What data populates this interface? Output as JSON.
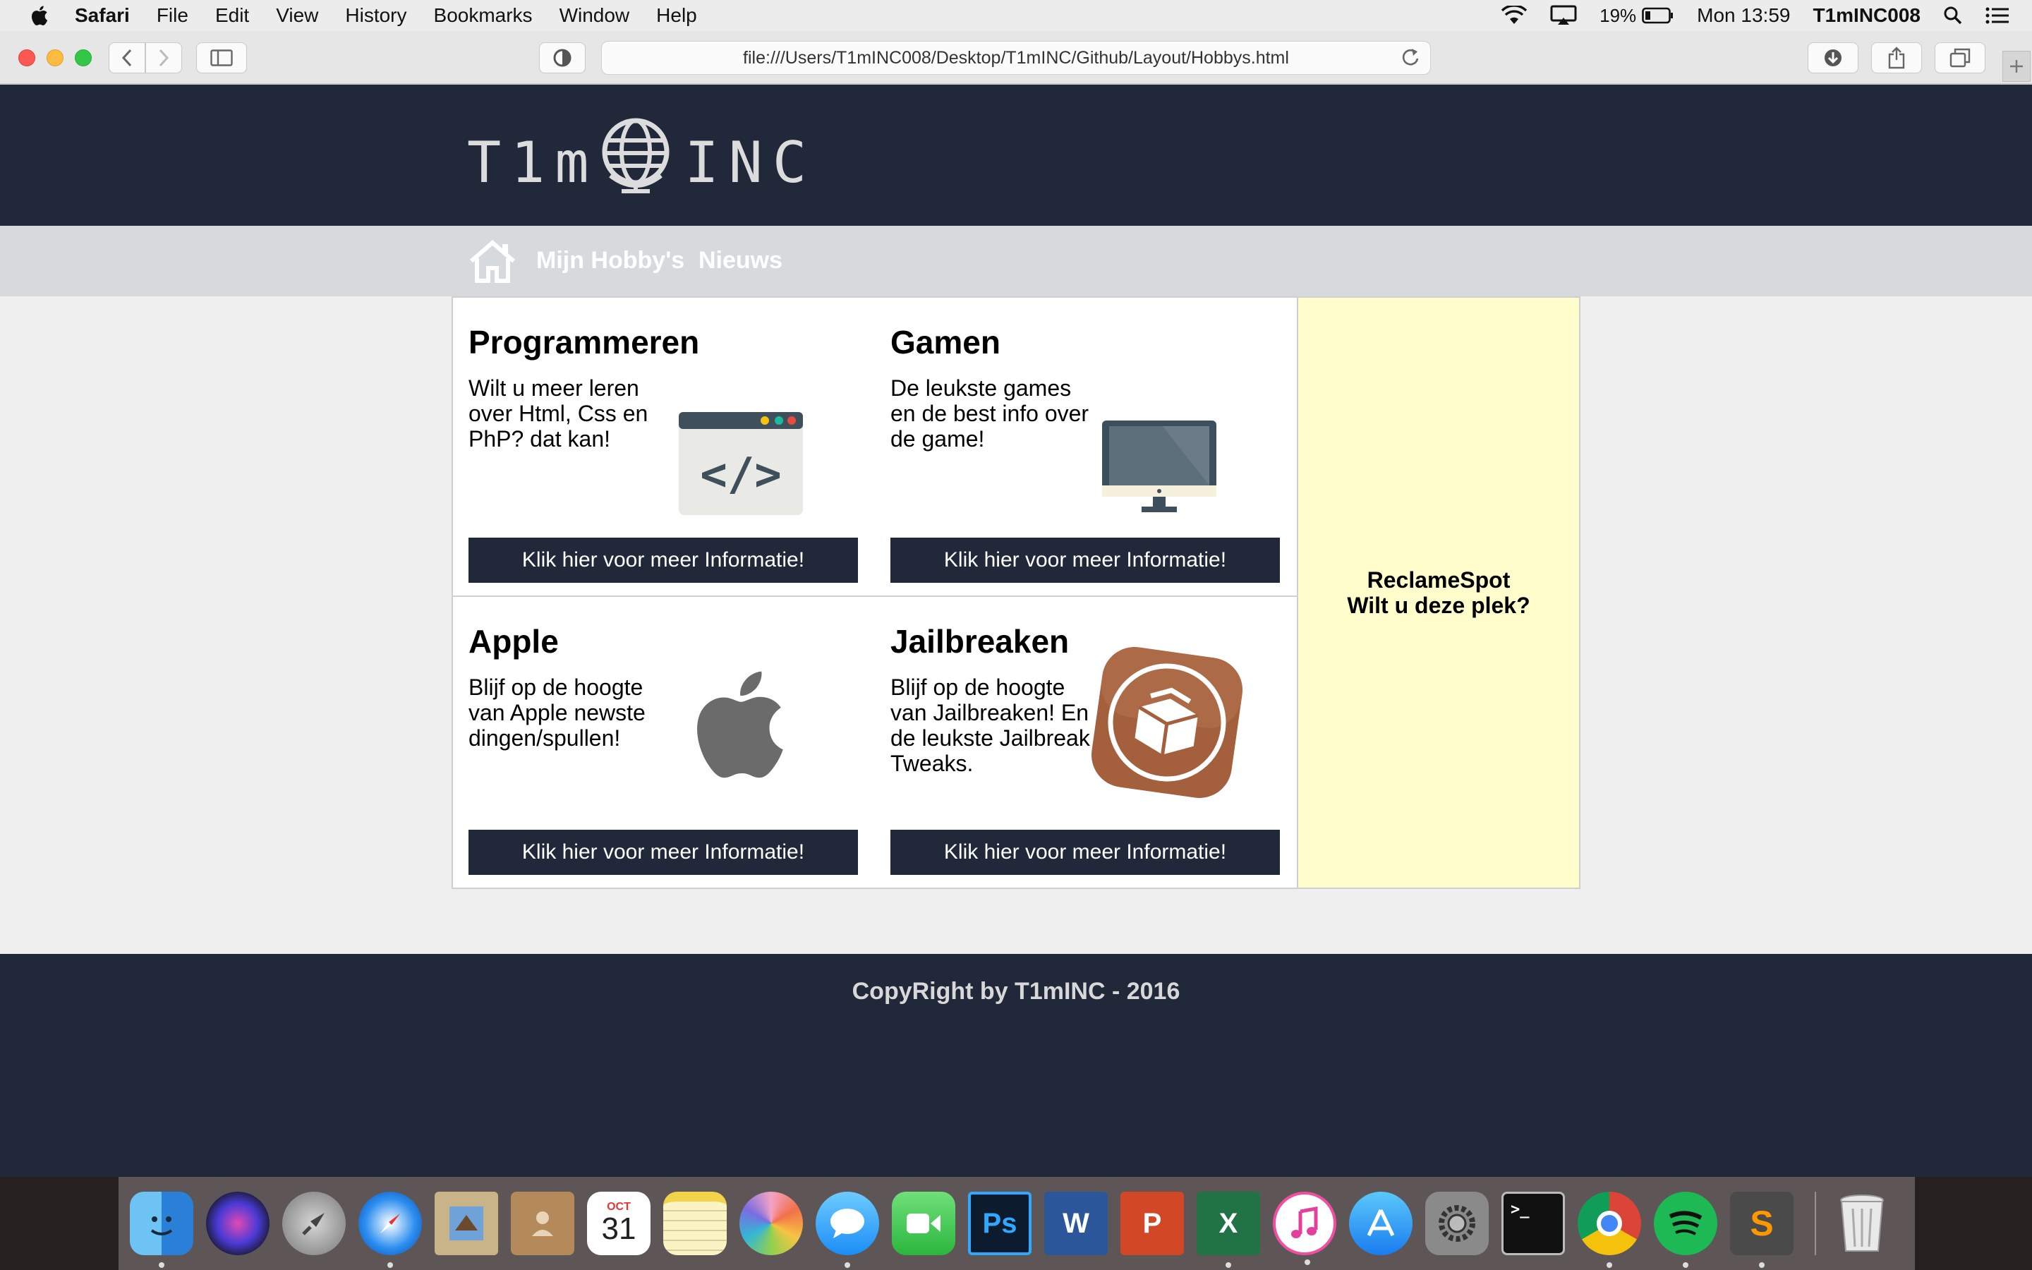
{
  "menubar": {
    "app": "Safari",
    "items": [
      "File",
      "Edit",
      "View",
      "History",
      "Bookmarks",
      "Window",
      "Help"
    ],
    "battery": "19%",
    "clock": "Mon 13:59",
    "user": "T1mINC008"
  },
  "browser": {
    "url": "file:///Users/T1mINC008/Desktop/T1mINC/Github/Layout/Hobbys.html"
  },
  "site": {
    "logo_left": "T1m",
    "logo_right": "INC",
    "nav": [
      "Mijn Hobby's",
      "Nieuws"
    ],
    "cards": [
      {
        "title": "Programmeren",
        "text": "Wilt u meer leren over Html, Css en PhP? dat kan!",
        "button": "Klik hier voor meer Informatie!",
        "icon": "code-icon"
      },
      {
        "title": "Gamen",
        "text": "De leukste games en de best info over de game!",
        "button": "Klik hier voor meer Informatie!",
        "icon": "imac-icon"
      },
      {
        "title": "Apple",
        "text": "Blijf op de hoogte van Apple newste dingen/spullen!",
        "button": "Klik hier voor meer Informatie!",
        "icon": "apple-logo-icon"
      },
      {
        "title": "Jailbreaken",
        "text": "Blijf op de hoogte van Jailbreaken! En de leukste Jailbreak Tweaks.",
        "button": "Klik hier voor meer Informatie!",
        "icon": "cydia-icon"
      }
    ],
    "ad": {
      "line1": "ReclameSpot",
      "line2": "Wilt u deze plek?"
    },
    "footer": "CopyRight by T1mINC - 2016"
  },
  "dock": {
    "calendar_month": "OCT",
    "calendar_day": "31",
    "photoshop": "Ps",
    "word": "W",
    "powerpoint": "P",
    "excel": "X",
    "terminal": ">_",
    "sublime": "S"
  },
  "colors": {
    "header_bg": "#21283a",
    "nav_bg": "#d7dadd",
    "ad_bg": "#fffdcc",
    "button_bg": "#21283a"
  }
}
